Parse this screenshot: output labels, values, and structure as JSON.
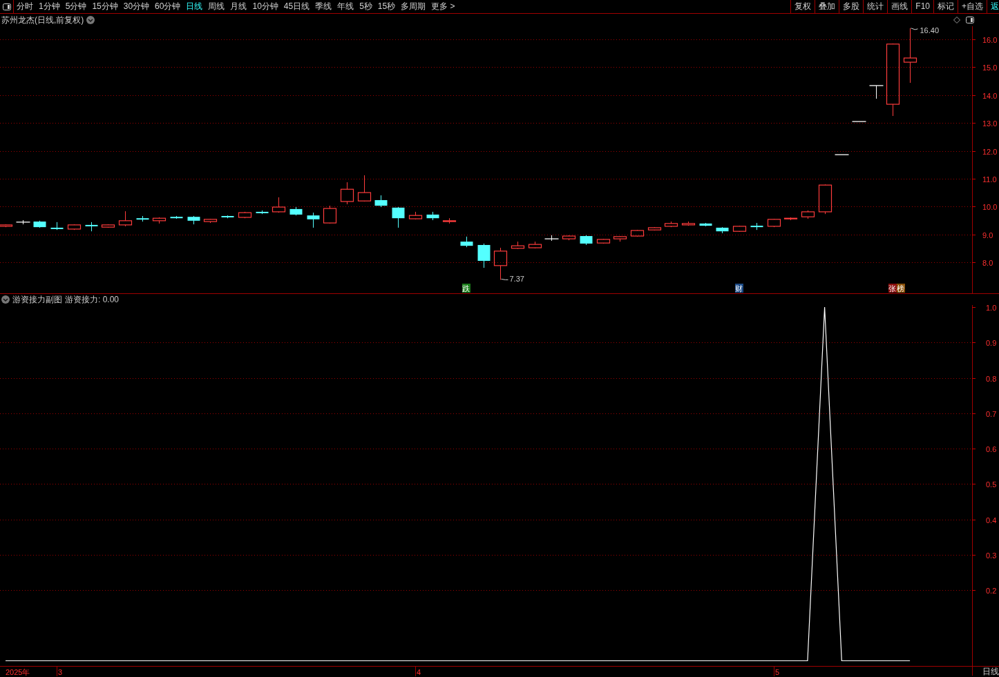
{
  "toolbar": {
    "tabs": [
      {
        "label": "分时",
        "selected": false
      },
      {
        "label": "1分钟",
        "selected": false
      },
      {
        "label": "5分钟",
        "selected": false
      },
      {
        "label": "15分钟",
        "selected": false
      },
      {
        "label": "30分钟",
        "selected": false
      },
      {
        "label": "60分钟",
        "selected": false
      },
      {
        "label": "日线",
        "selected": true
      },
      {
        "label": "周线",
        "selected": false
      },
      {
        "label": "月线",
        "selected": false
      },
      {
        "label": "10分钟",
        "selected": false
      },
      {
        "label": "45日线",
        "selected": false
      },
      {
        "label": "季线",
        "selected": false
      },
      {
        "label": "年线",
        "selected": false
      },
      {
        "label": "5秒",
        "selected": false
      },
      {
        "label": "15秒",
        "selected": false
      },
      {
        "label": "多周期",
        "selected": false
      },
      {
        "label": "更多 >",
        "selected": false
      }
    ],
    "buttons": [
      "复权",
      "叠加",
      "多股",
      "统计",
      "画线",
      "F10",
      "标记",
      "+自选"
    ],
    "back_button": {
      "label": "返"
    }
  },
  "price_panel": {
    "title": "苏州龙杰(日线,前复权)",
    "yticks": [
      "16.0",
      "15.0",
      "14.0",
      "13.0",
      "12.0",
      "11.0",
      "10.0",
      "9.0",
      "8.0"
    ],
    "high_label": "16.40",
    "low_label": "7.37",
    "signal_tags": [
      {
        "text": "跌",
        "color": "#1a7d1a"
      },
      {
        "text": "财",
        "color": "#1c4a86"
      },
      {
        "text": "张",
        "color": "#8a0c0c"
      },
      {
        "text": "榜",
        "color": "#8a5008"
      }
    ]
  },
  "indicator_panel": {
    "name": "游资接力副图",
    "reading": "游资接力: 0.00",
    "chart_data": {
      "type": "line",
      "grid": true,
      "ylim": [
        -0.044,
        1.006
      ],
      "yticks": [
        {
          "value": 1.0,
          "label": "1.0"
        },
        {
          "value": 0.9,
          "label": "0.9"
        },
        {
          "value": 0.8,
          "label": "0.8"
        },
        {
          "value": 0.7,
          "label": "0.7"
        },
        {
          "value": 0.6,
          "label": "0.6"
        },
        {
          "value": 0.5,
          "label": "0.5"
        },
        {
          "value": 0.4,
          "label": "0.4"
        },
        {
          "value": 0.3,
          "label": "0.3"
        },
        {
          "value": 0.2,
          "label": "0.2"
        }
      ],
      "series": [
        {
          "color": "#ffffff",
          "values": [
            0,
            0,
            0,
            0,
            0,
            0,
            0,
            0,
            0,
            0,
            0,
            0,
            0,
            0,
            0,
            0,
            0,
            0,
            0,
            0,
            0,
            0,
            0,
            0,
            0,
            0,
            0,
            0,
            0,
            0,
            0,
            0,
            0,
            0,
            0,
            0,
            0,
            0,
            0,
            0,
            0,
            0,
            0,
            0,
            0,
            0,
            0,
            0,
            1,
            0,
            0,
            0,
            0,
            0
          ]
        }
      ]
    }
  },
  "date_axis": [
    "2025年",
    "3",
    "4",
    "5"
  ],
  "period_label": "日线"
}
